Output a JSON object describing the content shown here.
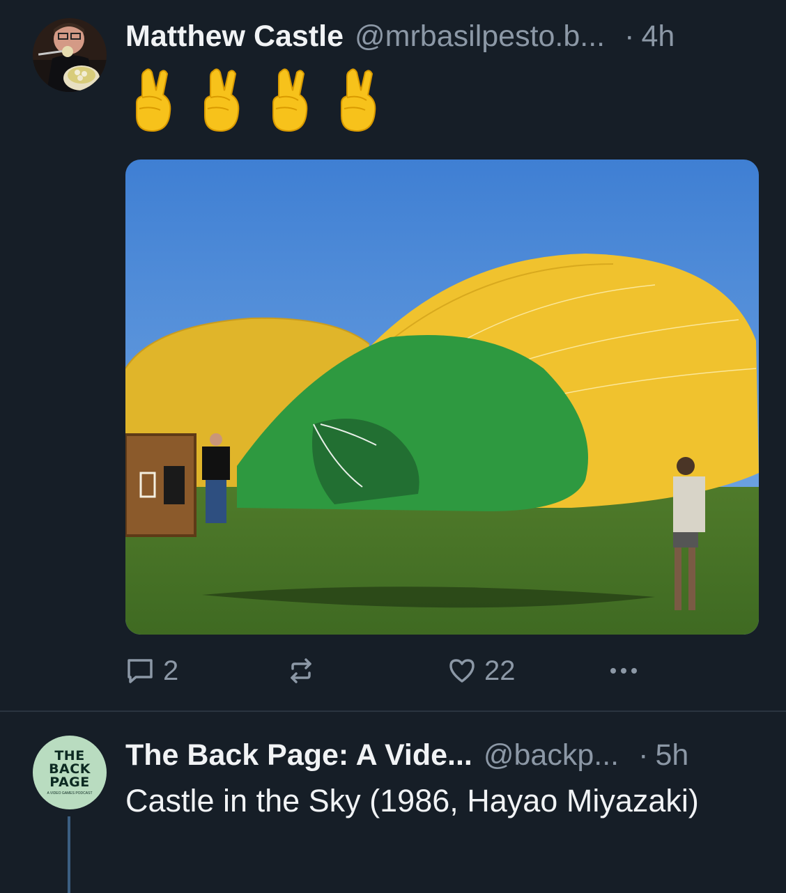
{
  "posts": [
    {
      "author_name": "Matthew Castle",
      "author_handle": "@mrbasilpesto.b...",
      "separator": "·",
      "time": "4h",
      "text": "🤞🤞🤞🤞",
      "image_icon": "hot-air-balloon-photo",
      "reply_count": "2",
      "like_count": "22"
    },
    {
      "author_name": "The Back Page: A Vide...",
      "author_handle": "@backp...",
      "separator": "·",
      "time": "5h",
      "text": "Castle in the Sky (1986, Hayao Miyazaki)",
      "avatar_text": "THE BACK PAGE",
      "avatar_subtext": "A VIDEO GAMES PODCAST"
    }
  ],
  "icons": {
    "reply": "speech-bubble-icon",
    "repost": "repost-arrows-icon",
    "like": "heart-icon",
    "more": "ellipsis-icon"
  },
  "colors": {
    "background": "#161e27",
    "muted_text": "#8c98a6",
    "thread_line": "#3b5f82"
  }
}
